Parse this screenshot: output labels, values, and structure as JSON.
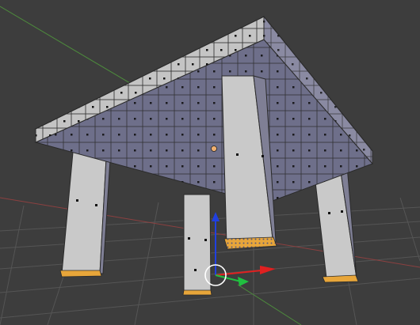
{
  "viewport": {
    "background_color": "#3d3d3d",
    "grid_color": "#555555",
    "x_axis_color": "#8c4040",
    "y_axis_color": "#4d8a3d",
    "mode": "edit"
  },
  "mesh": {
    "object": "table",
    "parts": [
      "tabletop",
      "front-left-leg",
      "front-right-leg",
      "back-left-leg",
      "back-right-leg"
    ],
    "face_light_color": "#c9c9c9",
    "face_dark_color": "#7f7f95",
    "face_underside_color": "#6e6f8a",
    "edge_color": "#2a2a2a",
    "selected_face_color": "#e8a63a"
  },
  "manipulator": {
    "x_axis_color": "#e02020",
    "y_axis_color": "#20c040",
    "z_axis_color": "#2040e0",
    "pivot_color": "#ffffff",
    "origin_color": "#f0b070"
  }
}
